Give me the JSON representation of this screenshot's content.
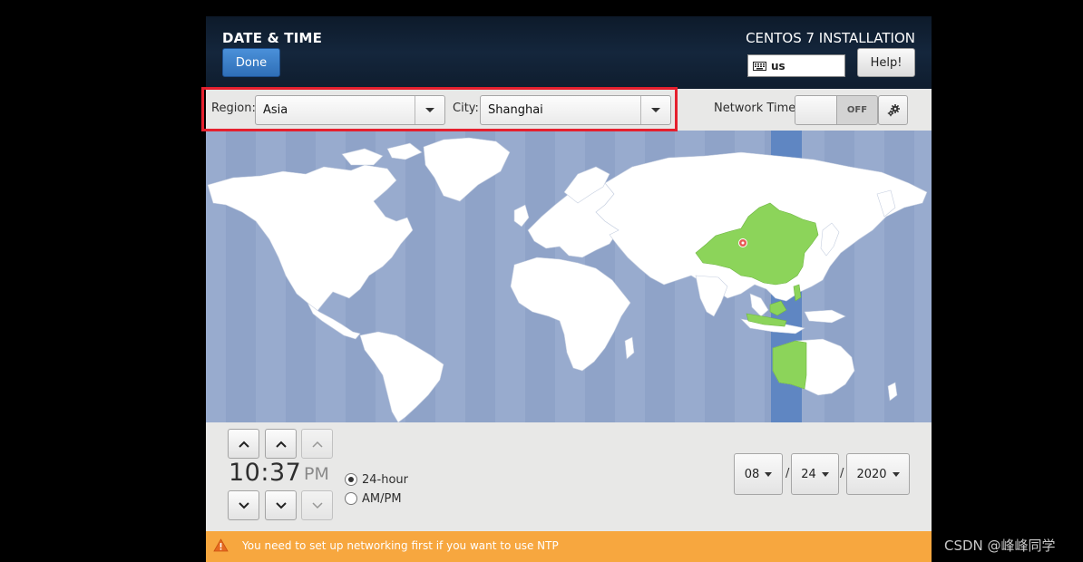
{
  "header": {
    "title": "DATE & TIME",
    "done_label": "Done",
    "installer_title": "CENTOS 7 INSTALLATION",
    "keyboard_layout": "us",
    "help_label": "Help!"
  },
  "toolbar": {
    "region_label": "Region:",
    "region_value": "Asia",
    "city_label": "City:",
    "city_value": "Shanghai",
    "network_time_label": "Network Time",
    "network_time_state": "OFF"
  },
  "map": {
    "highlight_color": "#8cd45a",
    "timezone_band_color": "#5f86c2",
    "ocean_color": "#8fa3c8",
    "selected_city_marker": "pin-icon"
  },
  "time": {
    "hours": "10",
    "separator": ":",
    "minutes": "37",
    "ampm": "PM",
    "format_24h_label": "24-hour",
    "format_ampm_label": "AM/PM",
    "selected_format": "24-hour"
  },
  "date": {
    "month": "08",
    "day": "24",
    "year": "2020",
    "separator": "/"
  },
  "warning": {
    "text": "You need to set up networking first if you want to use NTP",
    "icon": "warning-icon",
    "color": "#f7a73f"
  },
  "watermark": "CSDN @峰峰同学"
}
